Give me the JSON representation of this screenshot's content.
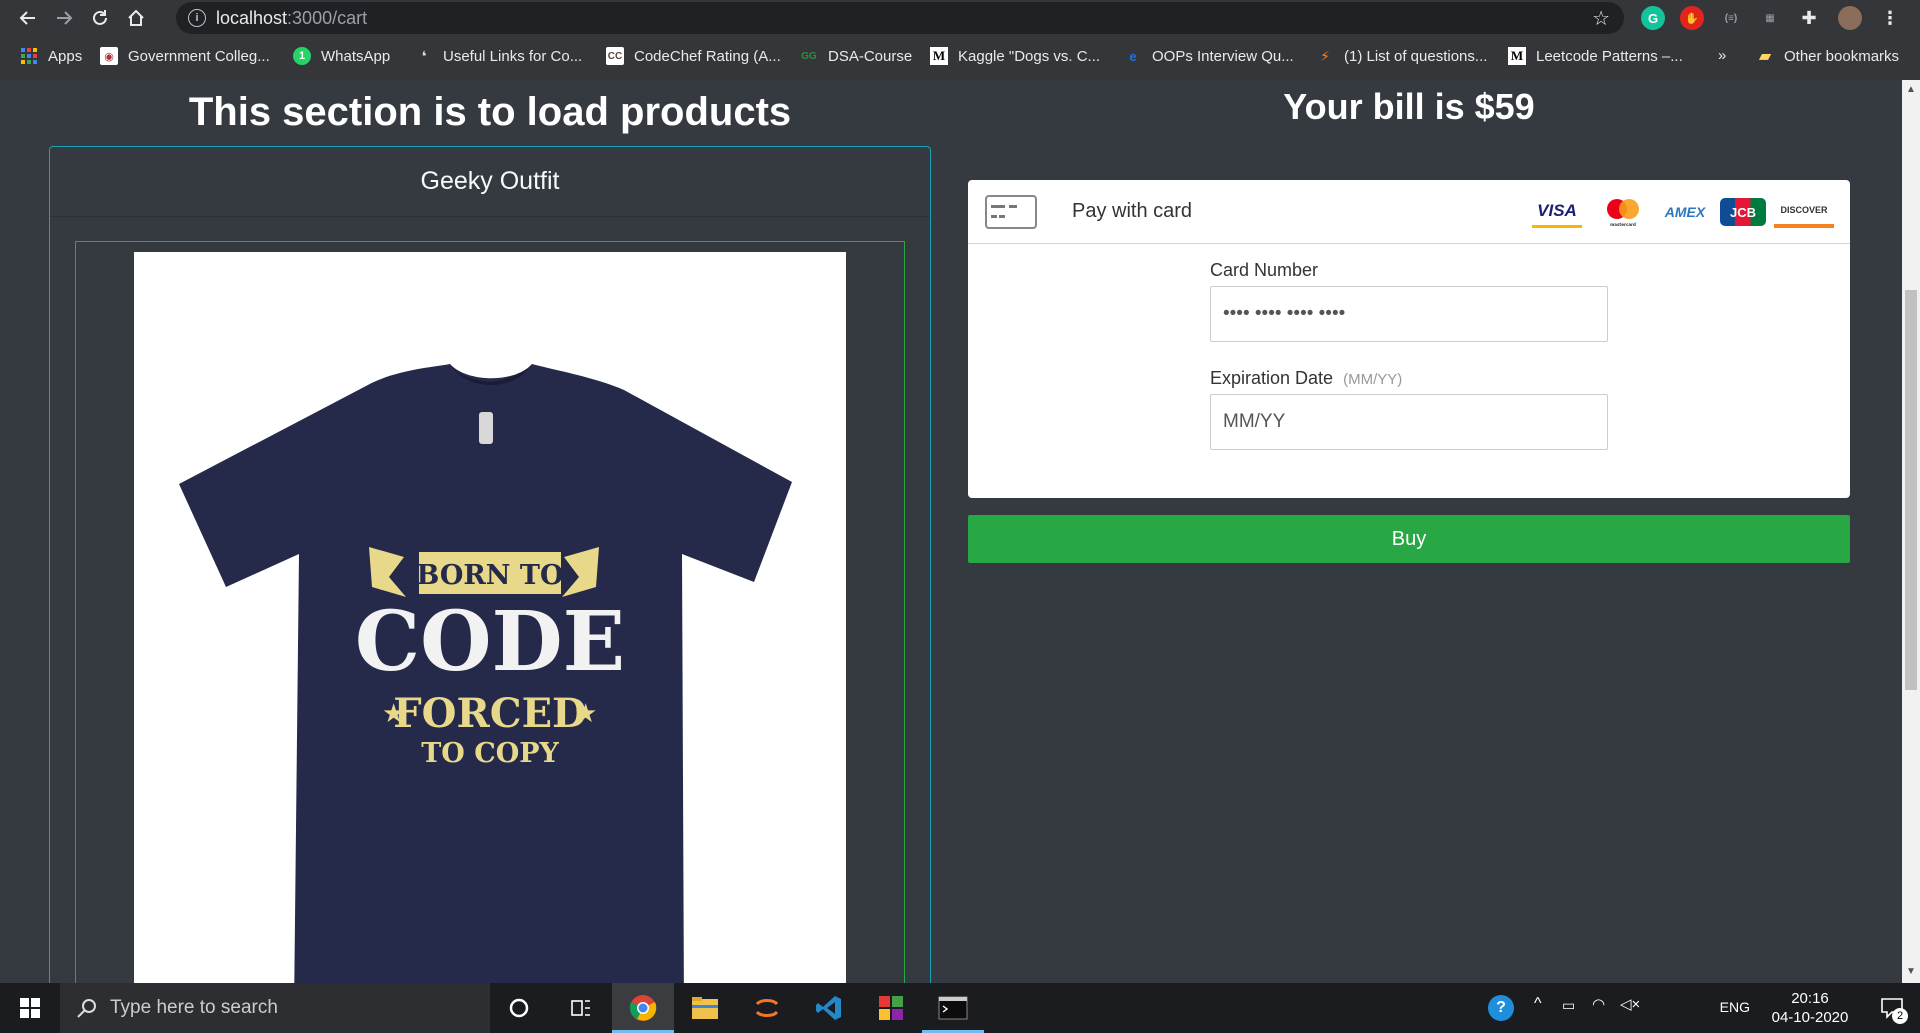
{
  "browser": {
    "url_host": "localhost",
    "url_path": ":3000/cart",
    "bookmarks": [
      {
        "label": "Apps"
      },
      {
        "label": "Government Colleg..."
      },
      {
        "label": "WhatsApp"
      },
      {
        "label": "Useful Links for Co..."
      },
      {
        "label": "CodeChef Rating (A..."
      },
      {
        "label": "DSA-Course"
      },
      {
        "label": "Kaggle \"Dogs vs. C..."
      },
      {
        "label": "OOPs Interview Qu..."
      },
      {
        "label": "(1) List of questions..."
      },
      {
        "label": "Leetcode Patterns –..."
      }
    ],
    "more_bookmarks": "»",
    "other_bookmarks": "Other bookmarks"
  },
  "products": {
    "heading": "This section is to load products",
    "card_title": "Geeky Outfit",
    "shirt_text": [
      "BORN TO",
      "CODE",
      "FORCED",
      "TO COPY"
    ]
  },
  "checkout": {
    "bill_heading": "Your bill is $59",
    "pay_title": "Pay with card",
    "brands": [
      "VISA",
      "AMEX",
      "JCB",
      "DISCOVER"
    ],
    "mastercard_label": "mastercard",
    "card_number_label": "Card Number",
    "card_number_placeholder": "•••• •••• •••• ••••",
    "expiry_label": "Expiration Date",
    "expiry_hint": "(MM/YY)",
    "expiry_placeholder": "MM/YY",
    "buy_label": "Buy"
  },
  "taskbar": {
    "search_placeholder": "Type here to search",
    "language": "ENG",
    "time": "20:16",
    "date": "04-10-2020",
    "notification_count": "2"
  },
  "colors": {
    "page_bg": "#343a40",
    "buy_green": "#28a745",
    "card_border": "#17a2b8",
    "shirt_navy": "#25294a",
    "print_yellow": "#e8d98a"
  }
}
